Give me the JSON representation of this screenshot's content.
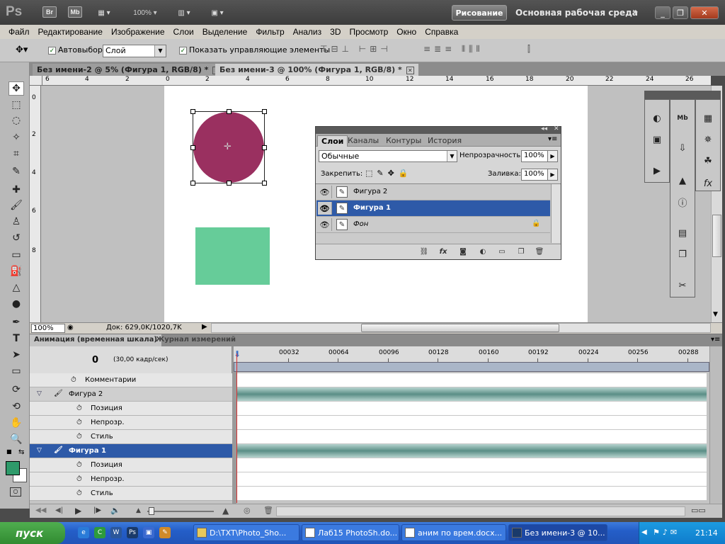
{
  "app": {
    "logo": "Ps",
    "top_buttons": [
      "Br",
      "Mb"
    ],
    "zoom": "100%",
    "workspace_active": "Рисование",
    "workspace_main": "Основная рабочая среда",
    "more": "»"
  },
  "menu": [
    "Файл",
    "Редактирование",
    "Изображение",
    "Слои",
    "Выделение",
    "Фильтр",
    "Анализ",
    "3D",
    "Просмотр",
    "Окно",
    "Справка"
  ],
  "options": {
    "autoselect_label": "Автовыбор:",
    "autoselect_value": "Слой",
    "show_controls_label": "Показать управляющие элементы"
  },
  "tabs": [
    {
      "label": "Без имени-2 @ 5% (Фигура 1, RGB/8) *"
    },
    {
      "label": "Без имени-3 @ 100% (Фигура 1, RGB/8) *"
    }
  ],
  "ruler_top": [
    "6",
    "4",
    "2",
    "0",
    "2",
    "4",
    "6",
    "8",
    "10",
    "12",
    "14",
    "16",
    "18",
    "20",
    "22",
    "24",
    "26"
  ],
  "ruler_left": [
    "0",
    "2",
    "4",
    "6",
    "8"
  ],
  "status": {
    "zoom": "100%",
    "doc": "Док: 629,0K/1020,7K"
  },
  "layers_panel": {
    "tabs": [
      "Слои",
      "Каналы",
      "Контуры",
      "История"
    ],
    "blend_mode": "Обычные",
    "opacity_label": "Непрозрачность:",
    "opacity_value": "100%",
    "lock_label": "Закрепить:",
    "fill_label": "Заливка:",
    "fill_value": "100%",
    "layers": [
      {
        "name": "Фигура 2",
        "selected": false
      },
      {
        "name": "Фигура 1",
        "selected": true
      },
      {
        "name": "Фон",
        "selected": false
      }
    ],
    "footer_fx": "fx"
  },
  "animation": {
    "tabs": [
      "Анимация (временная шкала)",
      "Журнал измерений"
    ],
    "current_frame": "0",
    "fps": "(30,00 кадр/сек)",
    "ticks": [
      "00032",
      "00064",
      "00096",
      "00128",
      "00160",
      "00192",
      "00224",
      "00256",
      "00288"
    ],
    "rows": [
      {
        "label": "Комментарии",
        "kind": "prop"
      },
      {
        "label": "Фигура 2",
        "kind": "group"
      },
      {
        "label": "Позиция",
        "kind": "prop"
      },
      {
        "label": "Непрозр.",
        "kind": "prop"
      },
      {
        "label": "Стиль",
        "kind": "prop"
      },
      {
        "label": "Фигура 1",
        "kind": "selected"
      },
      {
        "label": "Позиция",
        "kind": "prop"
      },
      {
        "label": "Непрозр.",
        "kind": "prop"
      },
      {
        "label": "Стиль",
        "kind": "prop"
      }
    ]
  },
  "taskbar": {
    "start": "пуск",
    "items": [
      {
        "label": "D:\\TXT\\Photo_Sho...",
        "active": false
      },
      {
        "label": "Лаб15 PhotoSh.do...",
        "active": false
      },
      {
        "label": "аним по врем.docx...",
        "active": false
      },
      {
        "label": "Без имени-3 @ 10...",
        "active": true
      }
    ],
    "clock": "21:14"
  },
  "colors": {
    "circle": "#9a3060",
    "rectangle": "#66cc99",
    "selection": "#2e5aa8",
    "foreground_swatch": "#2e9a6a"
  }
}
